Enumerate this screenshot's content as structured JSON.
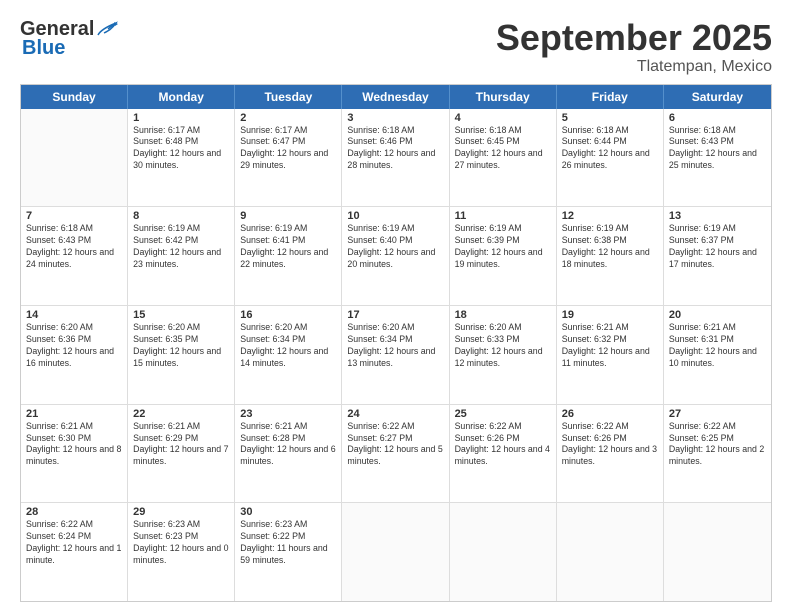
{
  "header": {
    "logo_general": "General",
    "logo_blue": "Blue",
    "month_title": "September 2025",
    "location": "Tlatempan, Mexico"
  },
  "days_of_week": [
    "Sunday",
    "Monday",
    "Tuesday",
    "Wednesday",
    "Thursday",
    "Friday",
    "Saturday"
  ],
  "weeks": [
    [
      {
        "day": "",
        "empty": true
      },
      {
        "day": "1",
        "sunrise": "Sunrise: 6:17 AM",
        "sunset": "Sunset: 6:48 PM",
        "daylight": "Daylight: 12 hours and 30 minutes."
      },
      {
        "day": "2",
        "sunrise": "Sunrise: 6:17 AM",
        "sunset": "Sunset: 6:47 PM",
        "daylight": "Daylight: 12 hours and 29 minutes."
      },
      {
        "day": "3",
        "sunrise": "Sunrise: 6:18 AM",
        "sunset": "Sunset: 6:46 PM",
        "daylight": "Daylight: 12 hours and 28 minutes."
      },
      {
        "day": "4",
        "sunrise": "Sunrise: 6:18 AM",
        "sunset": "Sunset: 6:45 PM",
        "daylight": "Daylight: 12 hours and 27 minutes."
      },
      {
        "day": "5",
        "sunrise": "Sunrise: 6:18 AM",
        "sunset": "Sunset: 6:44 PM",
        "daylight": "Daylight: 12 hours and 26 minutes."
      },
      {
        "day": "6",
        "sunrise": "Sunrise: 6:18 AM",
        "sunset": "Sunset: 6:43 PM",
        "daylight": "Daylight: 12 hours and 25 minutes."
      }
    ],
    [
      {
        "day": "7",
        "sunrise": "Sunrise: 6:18 AM",
        "sunset": "Sunset: 6:43 PM",
        "daylight": "Daylight: 12 hours and 24 minutes."
      },
      {
        "day": "8",
        "sunrise": "Sunrise: 6:19 AM",
        "sunset": "Sunset: 6:42 PM",
        "daylight": "Daylight: 12 hours and 23 minutes."
      },
      {
        "day": "9",
        "sunrise": "Sunrise: 6:19 AM",
        "sunset": "Sunset: 6:41 PM",
        "daylight": "Daylight: 12 hours and 22 minutes."
      },
      {
        "day": "10",
        "sunrise": "Sunrise: 6:19 AM",
        "sunset": "Sunset: 6:40 PM",
        "daylight": "Daylight: 12 hours and 20 minutes."
      },
      {
        "day": "11",
        "sunrise": "Sunrise: 6:19 AM",
        "sunset": "Sunset: 6:39 PM",
        "daylight": "Daylight: 12 hours and 19 minutes."
      },
      {
        "day": "12",
        "sunrise": "Sunrise: 6:19 AM",
        "sunset": "Sunset: 6:38 PM",
        "daylight": "Daylight: 12 hours and 18 minutes."
      },
      {
        "day": "13",
        "sunrise": "Sunrise: 6:19 AM",
        "sunset": "Sunset: 6:37 PM",
        "daylight": "Daylight: 12 hours and 17 minutes."
      }
    ],
    [
      {
        "day": "14",
        "sunrise": "Sunrise: 6:20 AM",
        "sunset": "Sunset: 6:36 PM",
        "daylight": "Daylight: 12 hours and 16 minutes."
      },
      {
        "day": "15",
        "sunrise": "Sunrise: 6:20 AM",
        "sunset": "Sunset: 6:35 PM",
        "daylight": "Daylight: 12 hours and 15 minutes."
      },
      {
        "day": "16",
        "sunrise": "Sunrise: 6:20 AM",
        "sunset": "Sunset: 6:34 PM",
        "daylight": "Daylight: 12 hours and 14 minutes."
      },
      {
        "day": "17",
        "sunrise": "Sunrise: 6:20 AM",
        "sunset": "Sunset: 6:34 PM",
        "daylight": "Daylight: 12 hours and 13 minutes."
      },
      {
        "day": "18",
        "sunrise": "Sunrise: 6:20 AM",
        "sunset": "Sunset: 6:33 PM",
        "daylight": "Daylight: 12 hours and 12 minutes."
      },
      {
        "day": "19",
        "sunrise": "Sunrise: 6:21 AM",
        "sunset": "Sunset: 6:32 PM",
        "daylight": "Daylight: 12 hours and 11 minutes."
      },
      {
        "day": "20",
        "sunrise": "Sunrise: 6:21 AM",
        "sunset": "Sunset: 6:31 PM",
        "daylight": "Daylight: 12 hours and 10 minutes."
      }
    ],
    [
      {
        "day": "21",
        "sunrise": "Sunrise: 6:21 AM",
        "sunset": "Sunset: 6:30 PM",
        "daylight": "Daylight: 12 hours and 8 minutes."
      },
      {
        "day": "22",
        "sunrise": "Sunrise: 6:21 AM",
        "sunset": "Sunset: 6:29 PM",
        "daylight": "Daylight: 12 hours and 7 minutes."
      },
      {
        "day": "23",
        "sunrise": "Sunrise: 6:21 AM",
        "sunset": "Sunset: 6:28 PM",
        "daylight": "Daylight: 12 hours and 6 minutes."
      },
      {
        "day": "24",
        "sunrise": "Sunrise: 6:22 AM",
        "sunset": "Sunset: 6:27 PM",
        "daylight": "Daylight: 12 hours and 5 minutes."
      },
      {
        "day": "25",
        "sunrise": "Sunrise: 6:22 AM",
        "sunset": "Sunset: 6:26 PM",
        "daylight": "Daylight: 12 hours and 4 minutes."
      },
      {
        "day": "26",
        "sunrise": "Sunrise: 6:22 AM",
        "sunset": "Sunset: 6:26 PM",
        "daylight": "Daylight: 12 hours and 3 minutes."
      },
      {
        "day": "27",
        "sunrise": "Sunrise: 6:22 AM",
        "sunset": "Sunset: 6:25 PM",
        "daylight": "Daylight: 12 hours and 2 minutes."
      }
    ],
    [
      {
        "day": "28",
        "sunrise": "Sunrise: 6:22 AM",
        "sunset": "Sunset: 6:24 PM",
        "daylight": "Daylight: 12 hours and 1 minute."
      },
      {
        "day": "29",
        "sunrise": "Sunrise: 6:23 AM",
        "sunset": "Sunset: 6:23 PM",
        "daylight": "Daylight: 12 hours and 0 minutes."
      },
      {
        "day": "30",
        "sunrise": "Sunrise: 6:23 AM",
        "sunset": "Sunset: 6:22 PM",
        "daylight": "Daylight: 11 hours and 59 minutes."
      },
      {
        "day": "",
        "empty": true
      },
      {
        "day": "",
        "empty": true
      },
      {
        "day": "",
        "empty": true
      },
      {
        "day": "",
        "empty": true
      }
    ]
  ]
}
